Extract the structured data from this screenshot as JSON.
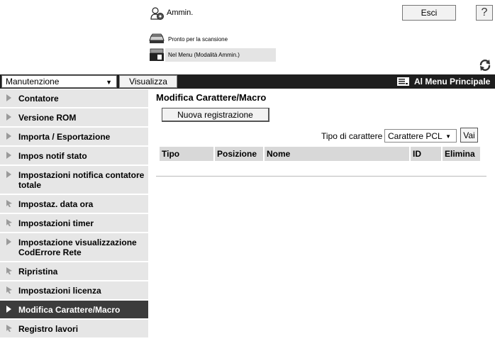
{
  "header": {
    "user_name": "Ammin.",
    "logout_label": "Esci",
    "help_label": "?",
    "status_ready": "Pronto per la scansione",
    "status_mode": "Nel Menu (Modalità Ammin.)"
  },
  "toolbar": {
    "menu_select_value": "Manutenzione",
    "view_label": "Visualizza",
    "main_menu_label": "Al Menu Principale"
  },
  "sidebar": {
    "items": [
      {
        "label": "Contatore"
      },
      {
        "label": "Versione ROM"
      },
      {
        "label": "Importa / Esportazione"
      },
      {
        "label": "Impos notif stato"
      },
      {
        "label": "Impostazioni notifica contatore totale"
      },
      {
        "label": "Impostaz. data ora"
      },
      {
        "label": "Impostazioni timer"
      },
      {
        "label": "Impostazione visualizzazione CodErrore Rete"
      },
      {
        "label": "Ripristina"
      },
      {
        "label": "Impostazioni licenza"
      },
      {
        "label": "Modifica Carattere/Macro"
      },
      {
        "label": "Registro lavori"
      }
    ]
  },
  "main": {
    "title": "Modifica Carattere/Macro",
    "new_registration_label": "Nuova registrazione",
    "font_type_label": "Tipo di carattere",
    "font_type_value": "Carattere PCL",
    "go_label": "Vai",
    "table_headers": [
      "Tipo",
      "Posizione",
      "Nome",
      "ID",
      "Elimina"
    ]
  },
  "colors": {
    "toolbar_bg": "#1e1e1e",
    "sidebar_bg": "#e6e6e6",
    "sidebar_active_bg": "#3c3c3c",
    "table_header_bg": "#d8d8d8"
  }
}
